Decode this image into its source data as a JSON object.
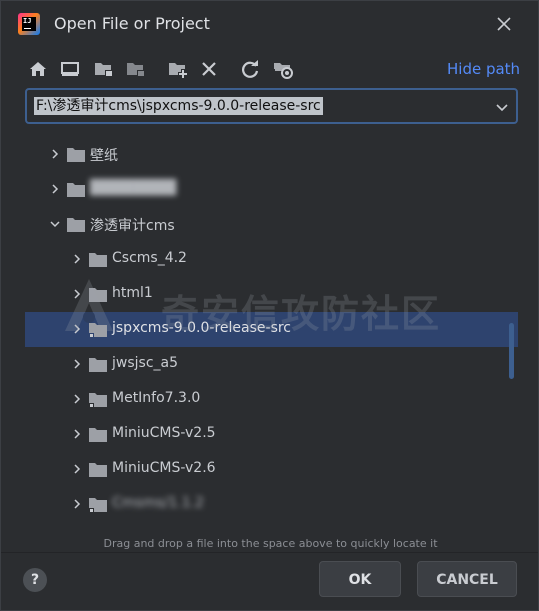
{
  "window": {
    "title": "Open File or Project",
    "app_icon_text": "IJ"
  },
  "toolbar": {
    "icons": [
      "home-icon",
      "desktop-icon",
      "project-folder-icon",
      "module-folder-icon",
      "new-folder-icon",
      "delete-icon",
      "refresh-icon",
      "show-hidden-icon"
    ],
    "hide_path_label": "Hide path"
  },
  "path": {
    "value": "F:\\渗透审计cms\\jspxcms-9.0.0-release-src"
  },
  "tree": {
    "items": [
      {
        "label": "壁纸",
        "expanded": false,
        "level": 0
      },
      {
        "label": "████████",
        "expanded": false,
        "level": 0,
        "obscured": true
      },
      {
        "label": "渗透审计cms",
        "expanded": true,
        "level": 0
      },
      {
        "label": "Cscms_4.2",
        "expanded": false,
        "level": 1
      },
      {
        "label": "html1",
        "expanded": false,
        "level": 1
      },
      {
        "label": "jspxcms-9.0.0-release-src",
        "expanded": false,
        "level": 1,
        "selected": true
      },
      {
        "label": "jwsjsc_a5",
        "expanded": false,
        "level": 1
      },
      {
        "label": "MetInfo7.3.0",
        "expanded": false,
        "level": 1
      },
      {
        "label": "MiniuCMS-v2.5",
        "expanded": false,
        "level": 1
      },
      {
        "label": "MiniuCMS-v2.6",
        "expanded": false,
        "level": 1
      },
      {
        "label": "Cmsms/1.1.2",
        "expanded": false,
        "level": 1
      }
    ]
  },
  "watermark": {
    "text": "奇安信攻防社区"
  },
  "hint": "Drag and drop a file into the space above to quickly locate it",
  "buttons": {
    "help": "?",
    "ok": "OK",
    "cancel": "CANCEL"
  },
  "colors": {
    "background": "#2b2d30",
    "accent": "#548af7",
    "selection": "#2e436e",
    "focus_border": "#3d5f8f"
  }
}
